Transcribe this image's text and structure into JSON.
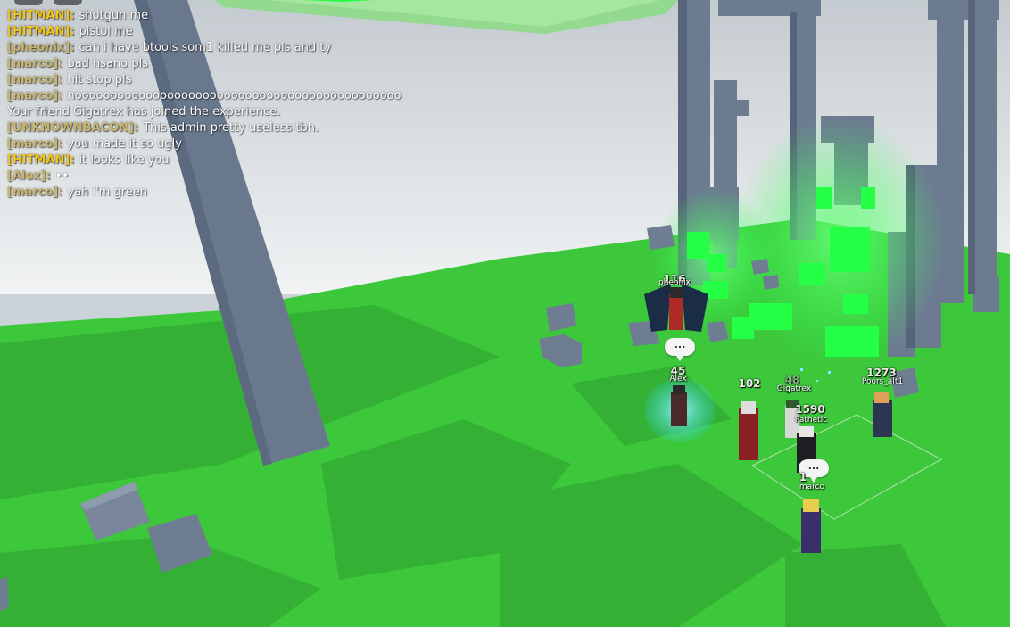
{
  "chat": {
    "messages": [
      {
        "name": "[HITMAN]:",
        "name_color": "#f0c419",
        "text": "shotgun me"
      },
      {
        "name": "[HITMAN]:",
        "name_color": "#f0c419",
        "text": "pistol me"
      },
      {
        "name": "[pheonix]:",
        "name_color": "#c9b66a",
        "text": "can i have btools som1 killed me pls and ty"
      },
      {
        "name": "[marco]:",
        "name_color": "#c9b66a",
        "text": "bad hsano pls"
      },
      {
        "name": "[marco]:",
        "name_color": "#c9b66a",
        "text": "hit stop pls"
      },
      {
        "name": "[marco]:",
        "name_color": "#c9b66a",
        "text": "noooooooooooooooooooooooooooooooooooooooooooooo"
      },
      {
        "name": "",
        "name_color": "#ffffff",
        "text": "Your friend Gigatrex has joined the experience."
      },
      {
        "name": "[UNKNOWNBACON]:",
        "name_color": "#c9b66a",
        "text": "This admin pretty useless tbh."
      },
      {
        "name": "[marco]:",
        "name_color": "#c9b66a",
        "text": "you made it so ugly"
      },
      {
        "name": "[HITMAN]:",
        "name_color": "#f0c419",
        "text": "it looks like you"
      },
      {
        "name": "[Alex]:",
        "name_color": "#c9b66a",
        "text": "••"
      },
      {
        "name": "[marco]:",
        "name_color": "#c9b66a",
        "text": "yah i'm green"
      }
    ]
  },
  "players": {
    "pheonix": {
      "name": "pheonix",
      "level": "116"
    },
    "alex": {
      "name": "Alex",
      "level": "45"
    },
    "unnamed": {
      "level": "102"
    },
    "gigatrex": {
      "name": "Gigatrex",
      "level": "48"
    },
    "pathetic": {
      "name": "Pathetic",
      "level": "1590"
    },
    "poors": {
      "name": "Poors_alt1",
      "level": "1273"
    },
    "marco": {
      "name": "marco",
      "level": "1"
    }
  },
  "bubbles": {
    "alex_bubble": "...",
    "marco_bubble": "..."
  },
  "colors": {
    "baseplate": "#3ec93e",
    "structure": "#6c7a90",
    "neon": "#2eff4f",
    "sky": "#e8ecef"
  }
}
